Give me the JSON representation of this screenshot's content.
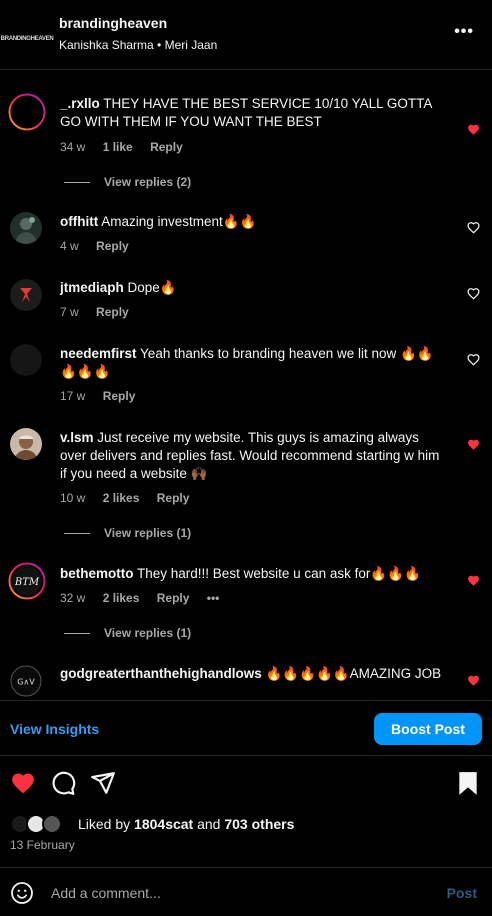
{
  "header": {
    "logo_text": "BRANDINGHEAVEN",
    "account": "brandingheaven",
    "subtitle": "Kanishka Sharma • Meri Jaan",
    "more": "•••"
  },
  "comments": [
    {
      "user": "_.rxllo",
      "text": "THEY HAVE THE BEST SERVICE 10/10 YALL GOTTA GO WITH THEM IF YOU WANT THE BEST",
      "age": "34 w",
      "likes": "1 like",
      "reply": "Reply",
      "liked": true,
      "view_replies": "View replies (2)"
    },
    {
      "user": "offhitt",
      "text": "Amazing investment🔥🔥",
      "age": "4 w",
      "reply": "Reply",
      "liked": false
    },
    {
      "user": "jtmediaph",
      "text": "Dope🔥",
      "age": "7 w",
      "reply": "Reply",
      "liked": false
    },
    {
      "user": "needemfirst",
      "text": "Yeah thanks to branding heaven we lit now 🔥🔥🔥🔥🔥",
      "age": "17 w",
      "reply": "Reply",
      "liked": false
    },
    {
      "user": "v.lsm",
      "text": "Just receive my website. This guys is amazing always over delivers and replies fast. Would recommend starting w him if you need a website 🙌🏾",
      "age": "10 w",
      "likes": "2 likes",
      "reply": "Reply",
      "liked": true,
      "view_replies": "View replies (1)"
    },
    {
      "user": "bethemotto",
      "text": "They hard!!! Best website u can ask for🔥🔥🔥",
      "age": "32 w",
      "likes": "2 likes",
      "reply": "Reply",
      "more": "•••",
      "liked": true,
      "view_replies": "View replies (1)"
    },
    {
      "user": "godgreaterthanthehighandlows",
      "text": "🔥🔥🔥🔥🔥AMAZING JOB",
      "liked": true
    }
  ],
  "avatars": {
    "bethemotto": "BTM",
    "godgreater": "G∧V"
  },
  "insights": {
    "view_insights": "View Insights",
    "boost": "Boost Post"
  },
  "likes": {
    "prefix": "Liked by",
    "user": "1804scat",
    "and": "and",
    "others": "703 others"
  },
  "date": "13 February",
  "add_comment": {
    "placeholder": "Add a comment...",
    "post": "Post"
  },
  "colors": {
    "background": "#000000",
    "heart_red": "#ff3040",
    "link_blue": "#2f9ef2",
    "button_blue": "#0095f6"
  }
}
